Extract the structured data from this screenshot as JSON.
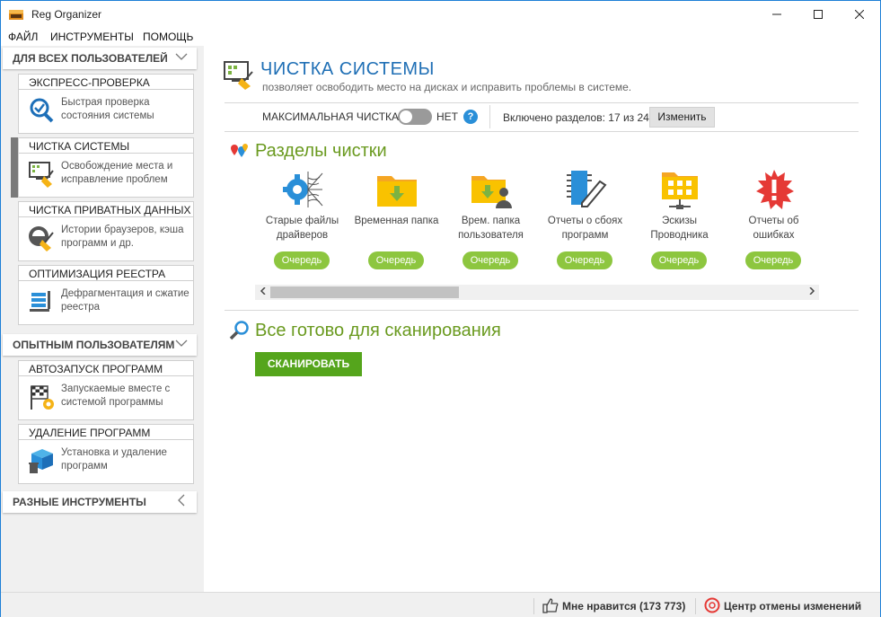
{
  "window": {
    "title": "Reg Organizer"
  },
  "menu": [
    "ФАЙЛ",
    "ИНСТРУМЕНТЫ",
    "ПОМОЩЬ"
  ],
  "sidebar": {
    "groups": [
      {
        "label": "ДЛЯ ВСЕХ ПОЛЬЗОВАТЕЛЕЙ"
      },
      {
        "label": "ОПЫТНЫМ ПОЛЬЗОВАТЕЛЯМ"
      },
      {
        "label": "РАЗНЫЕ ИНСТРУМЕНТЫ"
      }
    ],
    "cards": [
      {
        "title": "ЭКСПРЕСС-ПРОВЕРКА",
        "desc": "Быстрая проверка состояния системы",
        "icon": "check-magnifier-icon"
      },
      {
        "title": "ЧИСТКА СИСТЕМЫ",
        "desc": "Освобождение места и исправление проблем",
        "icon": "broom-monitor-icon"
      },
      {
        "title": "ЧИСТКА ПРИВАТНЫХ ДАННЫХ",
        "desc": "Истории браузеров, кэша программ и др.",
        "icon": "privacy-broom-icon"
      },
      {
        "title": "ОПТИМИЗАЦИЯ РЕЕСТРА",
        "desc": "Дефрагментация и сжатие реестра",
        "icon": "registry-compress-icon"
      },
      {
        "title": "АВТОЗАПУСК ПРОГРАММ",
        "desc": "Запускаемые вместе с системой программы",
        "icon": "startup-flag-icon"
      },
      {
        "title": "УДАЛЕНИЕ ПРОГРАММ",
        "desc": "Установка и удаление программ",
        "icon": "uninstall-box-icon"
      }
    ]
  },
  "main": {
    "title": "ЧИСТКА СИСТЕМЫ",
    "subtitle": "позволяет освободить место на дисках и исправить проблемы в системе.",
    "options": {
      "max_clean_label": "МАКСИМАЛЬНАЯ ЧИСТКА",
      "toggle_state": "НЕТ",
      "help": "?",
      "enabled_count": "Включено разделов: 17 из 24",
      "change_button": "Изменить"
    },
    "sections_title": "Разделы чистки",
    "items": [
      {
        "label": "Старые файлы драйверов",
        "button": "Очередь",
        "icon": "gear-web-icon"
      },
      {
        "label": "Временная папка",
        "button": "Очередь",
        "icon": "folder-download-icon"
      },
      {
        "label": "Врем. папка пользователя",
        "button": "Очередь",
        "icon": "user-folder-icon"
      },
      {
        "label": "Отчеты о сбоях программ",
        "button": "Очередь",
        "icon": "chip-pen-icon"
      },
      {
        "label": "Эскизы Проводника",
        "button": "Очередь",
        "icon": "thumbnail-folder-icon"
      },
      {
        "label": "Отчеты об ошибках",
        "button": "Очередь",
        "icon": "error-burst-icon"
      }
    ],
    "ready_title": "Все готово для сканирования",
    "scan_button": "СКАНИРОВАТЬ"
  },
  "status": {
    "like": "Мне нравится (173 773)",
    "undo_center": "Центр отмены изменений"
  },
  "colors": {
    "title_blue": "#1f6fb5",
    "section_green": "#6a9a1f",
    "pill_green": "#8dc63f",
    "scan_green": "#55a51c"
  }
}
